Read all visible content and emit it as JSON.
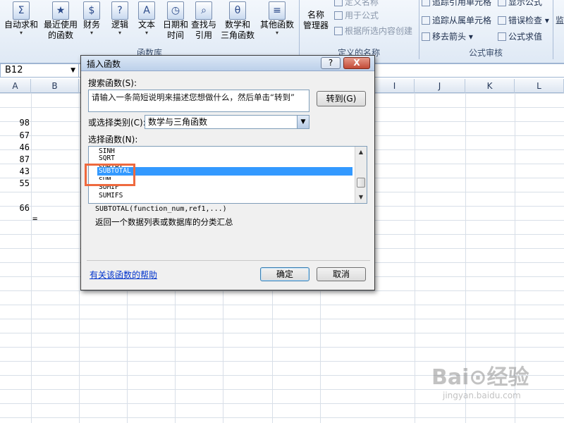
{
  "ribbon": {
    "buttons": [
      {
        "id": "autosum",
        "line1": "自动求和",
        "line2": "",
        "icon": "sigma-icon",
        "glyph": "Σ"
      },
      {
        "id": "recent",
        "line1": "最近使用",
        "line2": "的函数",
        "icon": "star-book-icon",
        "glyph": "★"
      },
      {
        "id": "financial",
        "line1": "财务",
        "line2": "",
        "icon": "finance-book-icon",
        "glyph": "$"
      },
      {
        "id": "logical",
        "line1": "逻辑",
        "line2": "",
        "icon": "logic-book-icon",
        "glyph": "?"
      },
      {
        "id": "text",
        "line1": "文本",
        "line2": "",
        "icon": "text-book-icon",
        "glyph": "A"
      },
      {
        "id": "datetime",
        "line1": "日期和",
        "line2": "时间",
        "icon": "calendar-book-icon",
        "glyph": "◷"
      },
      {
        "id": "lookup",
        "line1": "查找与",
        "line2": "引用",
        "icon": "lookup-book-icon",
        "glyph": "⌕"
      },
      {
        "id": "mathtrig",
        "line1": "数学和",
        "line2": "三角函数",
        "icon": "math-book-icon",
        "glyph": "θ"
      },
      {
        "id": "more",
        "line1": "其他函数",
        "line2": "",
        "icon": "more-book-icon",
        "glyph": "≡"
      }
    ],
    "group_function_library": "函数库",
    "name_manager": {
      "line1": "名称",
      "line2": "管理器"
    },
    "define_name": "定义名称",
    "use_in_formula": "用于公式",
    "create_from_selection": "根据所选内容创建",
    "group_defined_names": "定义的名称",
    "trace_precedents": "追踪引用单元格",
    "trace_dependents": "追踪从属单元格",
    "remove_arrows": "移去箭头",
    "show_formulas": "显示公式",
    "error_checking": "错误检查",
    "evaluate_formula": "公式求值",
    "group_formula_auditing": "公式审核",
    "watch_window": "监"
  },
  "namebox": {
    "value": "B12"
  },
  "columns": [
    "A",
    "B",
    "I",
    "J",
    "K",
    "L"
  ],
  "cells": [
    "98",
    "67",
    "46",
    "87",
    "43",
    "55",
    "",
    "66"
  ],
  "equals_cell": "=",
  "dialog": {
    "title": "插入函数",
    "help_btn": "?",
    "close_btn": "X",
    "search_label": "搜索函数(S):",
    "search_value": "请输入一条简短说明来描述您想做什么，然后单击“转到”",
    "go_button": "转到(G)",
    "category_label": "或选择类别(C):",
    "category_value": "数学与三角函数",
    "select_label": "选择函数(N):",
    "functions": [
      "SINH",
      "SQRT",
      "SQRTPI",
      "SUBTOTAL",
      "SUM",
      "SUMIF",
      "SUMIFS"
    ],
    "selected_function": "SUBTOTAL",
    "syntax": "SUBTOTAL(function_num,ref1,...)",
    "description": "返回一个数据列表或数据库的分类汇总",
    "help_link": "有关该函数的帮助",
    "ok_button": "确定",
    "cancel_button": "取消"
  },
  "watermark": {
    "logo": "Bai⊙经验",
    "url": "jingyan.baidu.com"
  },
  "colors": {
    "selection": "#3399ff",
    "highlight_box": "#ee6a3f",
    "link": "#0033cc"
  }
}
